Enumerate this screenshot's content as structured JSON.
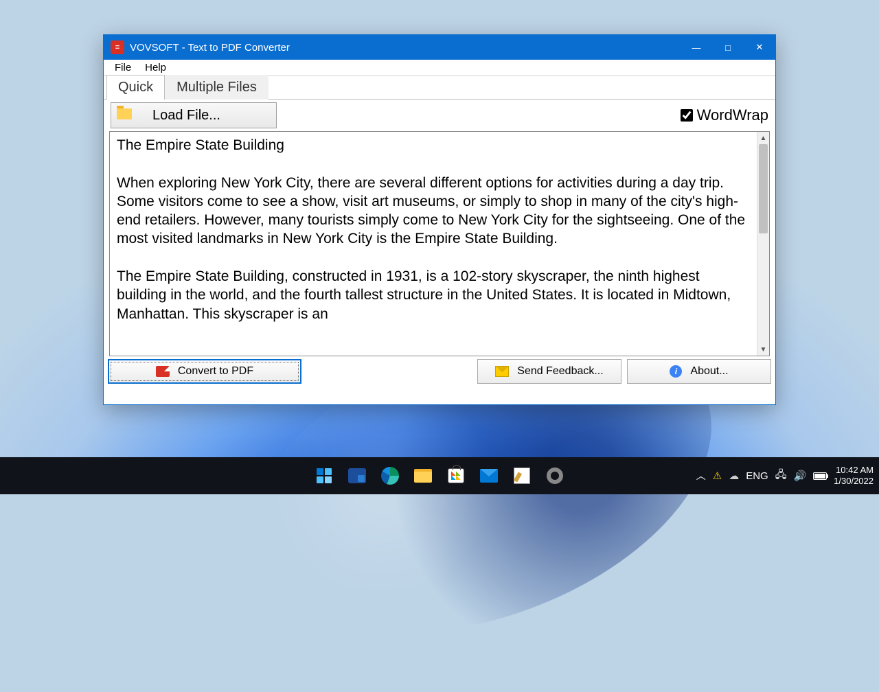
{
  "window": {
    "title": "VOVSOFT - Text to PDF Converter"
  },
  "menu": {
    "file": "File",
    "help": "Help"
  },
  "tabs": {
    "quick": "Quick",
    "multiple": "Multiple Files"
  },
  "toolbar": {
    "load_file": "Load File...",
    "wordwrap": "WordWrap",
    "wordwrap_checked": true
  },
  "content": {
    "text": "The Empire State Building\n\nWhen exploring New York City, there are several different options for activities during a day trip. Some visitors come to see a show, visit art museums, or simply to shop in many of the city's high-end retailers. However, many tourists simply come to New York City for the sightseeing. One of the most visited landmarks in New York City is the Empire State Building.\n\nThe Empire State Building, constructed in 1931, is a 102-story skyscraper, the ninth highest building in the world, and the fourth tallest structure in the United States. It is located in Midtown, Manhattan. This skyscraper is an"
  },
  "buttons": {
    "convert": "Convert to PDF",
    "feedback": "Send Feedback...",
    "about": "About..."
  },
  "taskbar": {
    "lang": "ENG",
    "time": "10:42 AM",
    "date": "1/30/2022"
  }
}
